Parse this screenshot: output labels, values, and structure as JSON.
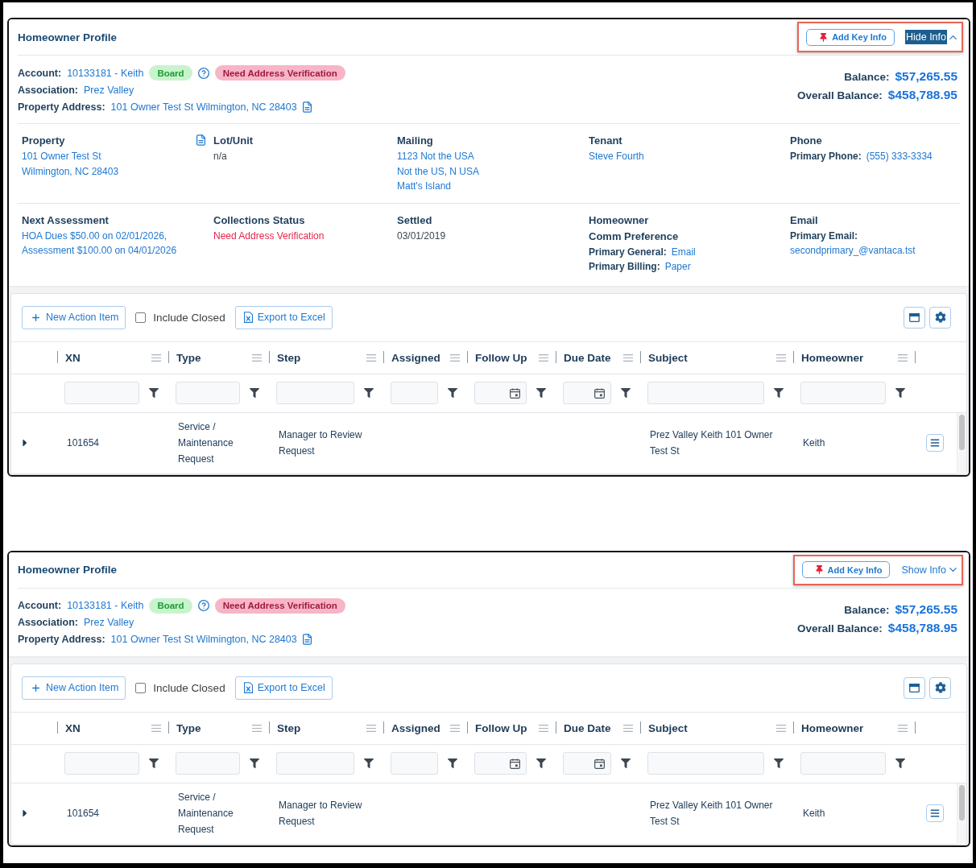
{
  "panels": [
    {
      "title": "Homeowner Profile",
      "key_info_button": "Add Key Info",
      "info_toggle": {
        "label": "Hide Info",
        "expanded": true,
        "highlighted": true
      },
      "account_fields": [
        {
          "label": "Account:",
          "value": "10133181 - Keith",
          "extras": [
            {
              "kind": "badge",
              "label": "Board",
              "color": "#c9f3cf"
            },
            {
              "kind": "help"
            },
            {
              "kind": "badge",
              "label": "Need Address Verification",
              "color": "#f7b5c7"
            }
          ]
        },
        {
          "label": "Association:",
          "value": "Prez Valley"
        },
        {
          "label": "Property Address:",
          "value": "101 Owner Test St Wilmington, NC 28403",
          "extras": [
            {
              "kind": "document"
            }
          ]
        }
      ],
      "balances": [
        {
          "label": "Balance:",
          "value": "$57,265.55"
        },
        {
          "label": "Overall Balance:",
          "value": "$458,788.95"
        }
      ],
      "details": [
        {
          "cells": [
            {
              "title": "Property",
              "lines": [
                {
                  "value": "101 Owner Test St",
                  "kind": "link"
                },
                {
                  "value": "Wilmington, NC 28403",
                  "kind": "link"
                }
              ],
              "extras": [
                {
                  "kind": "document"
                }
              ]
            },
            {
              "title": "Lot/Unit",
              "lines": [
                {
                  "value": "n/a",
                  "kind": "plain"
                }
              ]
            },
            {
              "title": "Mailing",
              "lines": [
                {
                  "value": "1123 Not the USA",
                  "kind": "link"
                },
                {
                  "value": "Not the US, N USA",
                  "kind": "link"
                },
                {
                  "value": "Matt's Island",
                  "kind": "link"
                }
              ]
            },
            {
              "title": "Tenant",
              "lines": [
                {
                  "value": "Steve Fourth",
                  "kind": "link"
                }
              ]
            },
            {
              "title": "Phone",
              "lines": [
                {
                  "label": "Primary Phone:",
                  "value": "(555) 333-3334",
                  "kind": "link"
                }
              ]
            }
          ]
        },
        {
          "cells": [
            {
              "title": "Next Assessment",
              "lines": [
                {
                  "value": "HOA Dues $50.00 on 02/01/2026,",
                  "kind": "link"
                },
                {
                  "value": "Assessment $100.00 on 04/01/2026",
                  "kind": "link"
                }
              ]
            },
            {
              "title": "Collections Status",
              "lines": [
                {
                  "value": "Need Address Verification",
                  "kind": "alert"
                }
              ]
            },
            {
              "title": "Settled",
              "lines": [
                {
                  "value": "03/01/2019",
                  "kind": "plain"
                }
              ]
            },
            {
              "title": "Homeowner",
              "subtitle": "Comm Preference",
              "lines": [
                {
                  "label": "Primary General:",
                  "value": "Email",
                  "kind": "link"
                },
                {
                  "label": "Primary Billing:",
                  "value": "Paper",
                  "kind": "link"
                }
              ]
            },
            {
              "title": "Email",
              "lines": [
                {
                  "label": "Primary Email:"
                },
                {
                  "value": "secondprimary_@vantaca.tst",
                  "kind": "link"
                }
              ]
            }
          ]
        }
      ],
      "table": {
        "toolbar": {
          "new_button": "New Action Item",
          "include_closed": {
            "label": "Include Closed",
            "checked": false
          },
          "export_button": "Export to Excel"
        },
        "columns": [
          {
            "label": "XN",
            "kind": "text"
          },
          {
            "label": "Type",
            "kind": "text"
          },
          {
            "label": "Step",
            "kind": "text"
          },
          {
            "label": "Assigned",
            "kind": "text"
          },
          {
            "label": "Follow Up",
            "kind": "date"
          },
          {
            "label": "Due Date",
            "kind": "date"
          },
          {
            "label": "Subject",
            "kind": "text"
          },
          {
            "label": "Homeowner",
            "kind": "text"
          }
        ],
        "rows": [
          {
            "expanded": false,
            "cells": [
              "101654",
              "Service / Maintenance Request",
              "Manager to Review Request",
              null,
              null,
              null,
              "Prez Valley Keith 101 Owner Test St",
              "Keith"
            ]
          }
        ]
      }
    },
    {
      "title": "Homeowner Profile",
      "key_info_button": "Add Key Info",
      "info_toggle": {
        "label": "Show Info",
        "expanded": false,
        "highlighted": false
      },
      "account_fields": [
        {
          "label": "Account:",
          "value": "10133181 - Keith",
          "extras": [
            {
              "kind": "badge",
              "label": "Board",
              "color": "#c9f3cf"
            },
            {
              "kind": "help"
            },
            {
              "kind": "badge",
              "label": "Need Address Verification",
              "color": "#f7b5c7"
            }
          ]
        },
        {
          "label": "Association:",
          "value": "Prez Valley"
        },
        {
          "label": "Property Address:",
          "value": "101 Owner Test St Wilmington, NC 28403",
          "extras": [
            {
              "kind": "document"
            }
          ]
        }
      ],
      "balances": [
        {
          "label": "Balance:",
          "value": "$57,265.55"
        },
        {
          "label": "Overall Balance:",
          "value": "$458,788.95"
        }
      ],
      "table": {
        "toolbar": {
          "new_button": "New Action Item",
          "include_closed": {
            "label": "Include Closed",
            "checked": false
          },
          "export_button": "Export to Excel"
        },
        "columns": [
          {
            "label": "XN",
            "kind": "text"
          },
          {
            "label": "Type",
            "kind": "text"
          },
          {
            "label": "Step",
            "kind": "text"
          },
          {
            "label": "Assigned",
            "kind": "text"
          },
          {
            "label": "Follow Up",
            "kind": "date"
          },
          {
            "label": "Due Date",
            "kind": "date"
          },
          {
            "label": "Subject",
            "kind": "text"
          },
          {
            "label": "Homeowner",
            "kind": "text"
          }
        ],
        "rows": [
          {
            "expanded": false,
            "cells": [
              "101654",
              "Service / Maintenance Request",
              "Manager to Review Request",
              null,
              null,
              null,
              "Prez Valley Keith 101 Owner Test St",
              "Keith"
            ]
          }
        ]
      }
    }
  ]
}
